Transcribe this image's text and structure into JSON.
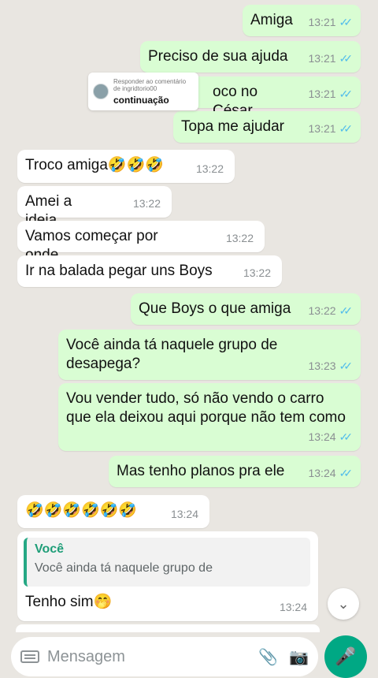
{
  "messages": [
    {
      "dir": "out",
      "text": "Amiga",
      "time": "13:21"
    },
    {
      "dir": "out",
      "text": "Preciso de sua ajuda",
      "time": "13:21"
    },
    {
      "dir": "out",
      "text": "oco no César",
      "time": "13:21"
    },
    {
      "dir": "out",
      "text": "Topa me ajudar",
      "time": "13:21"
    },
    {
      "dir": "in",
      "text": "Troco amiga🤣🤣🤣",
      "time": "13:22"
    },
    {
      "dir": "in",
      "text": "Amei a ideia",
      "time": "13:22"
    },
    {
      "dir": "in",
      "text": "Vamos começar por onde",
      "time": "13:22"
    },
    {
      "dir": "in",
      "text": "Ir na balada pegar uns Boys",
      "time": "13:22"
    },
    {
      "dir": "out",
      "text": "Que Boys o que amiga",
      "time": "13:22"
    },
    {
      "dir": "out",
      "text": "Você ainda tá naquele grupo de desapega?",
      "time": "13:23"
    },
    {
      "dir": "out",
      "text": "Vou vender tudo, só não vendo o carro que ela deixou aqui porque não tem como",
      "time": "13:24"
    },
    {
      "dir": "out",
      "text": "Mas tenho planos pra ele",
      "time": "13:24"
    },
    {
      "dir": "in",
      "text": "🤣🤣🤣🤣🤣🤣",
      "time": "13:24"
    },
    {
      "dir": "in",
      "text": "Tenho sim🤭",
      "time": "13:24"
    }
  ],
  "reply_quote": {
    "author": "Você",
    "text": "Você ainda tá naquele grupo de"
  },
  "comment_overlay": {
    "title": "Responder ao comentário de ingridtorio00",
    "label": "continuação"
  },
  "input": {
    "placeholder": "Mensagem"
  },
  "icons": {
    "keyboard": "keyboard-icon",
    "attach": "paperclip-icon",
    "camera": "camera-icon",
    "mic": "mic-icon",
    "scroll": "chevron-down-icon",
    "ticks": "double-check-icon"
  },
  "colors": {
    "outgoing": "#d9fdd3",
    "incoming": "#ffffff",
    "accent": "#00a884",
    "ticks": "#53bdeb"
  }
}
